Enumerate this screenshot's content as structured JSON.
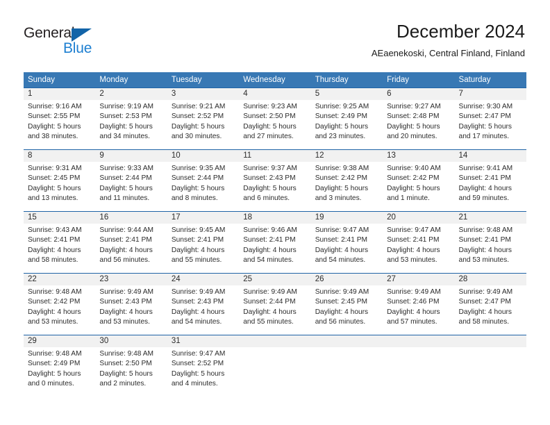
{
  "brand": {
    "name_dark": "General",
    "name_light": "Blue",
    "accent_color": "#1264a8",
    "light_color": "#1d7fd1"
  },
  "header": {
    "title": "December 2024",
    "subtitle": "AEaenekoski, Central Finland, Finland"
  },
  "theme": {
    "header_row_bg": "#3878b4",
    "row_divider": "#1f63a6",
    "day_band_bg": "#f1f1f1",
    "text": "#2b2b2b"
  },
  "weekdays": [
    "Sunday",
    "Monday",
    "Tuesday",
    "Wednesday",
    "Thursday",
    "Friday",
    "Saturday"
  ],
  "weeks": [
    {
      "days": [
        {
          "num": "1",
          "l1": "Sunrise: 9:16 AM",
          "l2": "Sunset: 2:55 PM",
          "l3": "Daylight: 5 hours",
          "l4": "and 38 minutes."
        },
        {
          "num": "2",
          "l1": "Sunrise: 9:19 AM",
          "l2": "Sunset: 2:53 PM",
          "l3": "Daylight: 5 hours",
          "l4": "and 34 minutes."
        },
        {
          "num": "3",
          "l1": "Sunrise: 9:21 AM",
          "l2": "Sunset: 2:52 PM",
          "l3": "Daylight: 5 hours",
          "l4": "and 30 minutes."
        },
        {
          "num": "4",
          "l1": "Sunrise: 9:23 AM",
          "l2": "Sunset: 2:50 PM",
          "l3": "Daylight: 5 hours",
          "l4": "and 27 minutes."
        },
        {
          "num": "5",
          "l1": "Sunrise: 9:25 AM",
          "l2": "Sunset: 2:49 PM",
          "l3": "Daylight: 5 hours",
          "l4": "and 23 minutes."
        },
        {
          "num": "6",
          "l1": "Sunrise: 9:27 AM",
          "l2": "Sunset: 2:48 PM",
          "l3": "Daylight: 5 hours",
          "l4": "and 20 minutes."
        },
        {
          "num": "7",
          "l1": "Sunrise: 9:30 AM",
          "l2": "Sunset: 2:47 PM",
          "l3": "Daylight: 5 hours",
          "l4": "and 17 minutes."
        }
      ]
    },
    {
      "days": [
        {
          "num": "8",
          "l1": "Sunrise: 9:31 AM",
          "l2": "Sunset: 2:45 PM",
          "l3": "Daylight: 5 hours",
          "l4": "and 13 minutes."
        },
        {
          "num": "9",
          "l1": "Sunrise: 9:33 AM",
          "l2": "Sunset: 2:44 PM",
          "l3": "Daylight: 5 hours",
          "l4": "and 11 minutes."
        },
        {
          "num": "10",
          "l1": "Sunrise: 9:35 AM",
          "l2": "Sunset: 2:44 PM",
          "l3": "Daylight: 5 hours",
          "l4": "and 8 minutes."
        },
        {
          "num": "11",
          "l1": "Sunrise: 9:37 AM",
          "l2": "Sunset: 2:43 PM",
          "l3": "Daylight: 5 hours",
          "l4": "and 6 minutes."
        },
        {
          "num": "12",
          "l1": "Sunrise: 9:38 AM",
          "l2": "Sunset: 2:42 PM",
          "l3": "Daylight: 5 hours",
          "l4": "and 3 minutes."
        },
        {
          "num": "13",
          "l1": "Sunrise: 9:40 AM",
          "l2": "Sunset: 2:42 PM",
          "l3": "Daylight: 5 hours",
          "l4": "and 1 minute."
        },
        {
          "num": "14",
          "l1": "Sunrise: 9:41 AM",
          "l2": "Sunset: 2:41 PM",
          "l3": "Daylight: 4 hours",
          "l4": "and 59 minutes."
        }
      ]
    },
    {
      "days": [
        {
          "num": "15",
          "l1": "Sunrise: 9:43 AM",
          "l2": "Sunset: 2:41 PM",
          "l3": "Daylight: 4 hours",
          "l4": "and 58 minutes."
        },
        {
          "num": "16",
          "l1": "Sunrise: 9:44 AM",
          "l2": "Sunset: 2:41 PM",
          "l3": "Daylight: 4 hours",
          "l4": "and 56 minutes."
        },
        {
          "num": "17",
          "l1": "Sunrise: 9:45 AM",
          "l2": "Sunset: 2:41 PM",
          "l3": "Daylight: 4 hours",
          "l4": "and 55 minutes."
        },
        {
          "num": "18",
          "l1": "Sunrise: 9:46 AM",
          "l2": "Sunset: 2:41 PM",
          "l3": "Daylight: 4 hours",
          "l4": "and 54 minutes."
        },
        {
          "num": "19",
          "l1": "Sunrise: 9:47 AM",
          "l2": "Sunset: 2:41 PM",
          "l3": "Daylight: 4 hours",
          "l4": "and 54 minutes."
        },
        {
          "num": "20",
          "l1": "Sunrise: 9:47 AM",
          "l2": "Sunset: 2:41 PM",
          "l3": "Daylight: 4 hours",
          "l4": "and 53 minutes."
        },
        {
          "num": "21",
          "l1": "Sunrise: 9:48 AM",
          "l2": "Sunset: 2:41 PM",
          "l3": "Daylight: 4 hours",
          "l4": "and 53 minutes."
        }
      ]
    },
    {
      "days": [
        {
          "num": "22",
          "l1": "Sunrise: 9:48 AM",
          "l2": "Sunset: 2:42 PM",
          "l3": "Daylight: 4 hours",
          "l4": "and 53 minutes."
        },
        {
          "num": "23",
          "l1": "Sunrise: 9:49 AM",
          "l2": "Sunset: 2:43 PM",
          "l3": "Daylight: 4 hours",
          "l4": "and 53 minutes."
        },
        {
          "num": "24",
          "l1": "Sunrise: 9:49 AM",
          "l2": "Sunset: 2:43 PM",
          "l3": "Daylight: 4 hours",
          "l4": "and 54 minutes."
        },
        {
          "num": "25",
          "l1": "Sunrise: 9:49 AM",
          "l2": "Sunset: 2:44 PM",
          "l3": "Daylight: 4 hours",
          "l4": "and 55 minutes."
        },
        {
          "num": "26",
          "l1": "Sunrise: 9:49 AM",
          "l2": "Sunset: 2:45 PM",
          "l3": "Daylight: 4 hours",
          "l4": "and 56 minutes."
        },
        {
          "num": "27",
          "l1": "Sunrise: 9:49 AM",
          "l2": "Sunset: 2:46 PM",
          "l3": "Daylight: 4 hours",
          "l4": "and 57 minutes."
        },
        {
          "num": "28",
          "l1": "Sunrise: 9:49 AM",
          "l2": "Sunset: 2:47 PM",
          "l3": "Daylight: 4 hours",
          "l4": "and 58 minutes."
        }
      ]
    },
    {
      "days": [
        {
          "num": "29",
          "l1": "Sunrise: 9:48 AM",
          "l2": "Sunset: 2:49 PM",
          "l3": "Daylight: 5 hours",
          "l4": "and 0 minutes."
        },
        {
          "num": "30",
          "l1": "Sunrise: 9:48 AM",
          "l2": "Sunset: 2:50 PM",
          "l3": "Daylight: 5 hours",
          "l4": "and 2 minutes."
        },
        {
          "num": "31",
          "l1": "Sunrise: 9:47 AM",
          "l2": "Sunset: 2:52 PM",
          "l3": "Daylight: 5 hours",
          "l4": "and 4 minutes."
        },
        {
          "num": "",
          "l1": "",
          "l2": "",
          "l3": "",
          "l4": ""
        },
        {
          "num": "",
          "l1": "",
          "l2": "",
          "l3": "",
          "l4": ""
        },
        {
          "num": "",
          "l1": "",
          "l2": "",
          "l3": "",
          "l4": ""
        },
        {
          "num": "",
          "l1": "",
          "l2": "",
          "l3": "",
          "l4": ""
        }
      ]
    }
  ]
}
